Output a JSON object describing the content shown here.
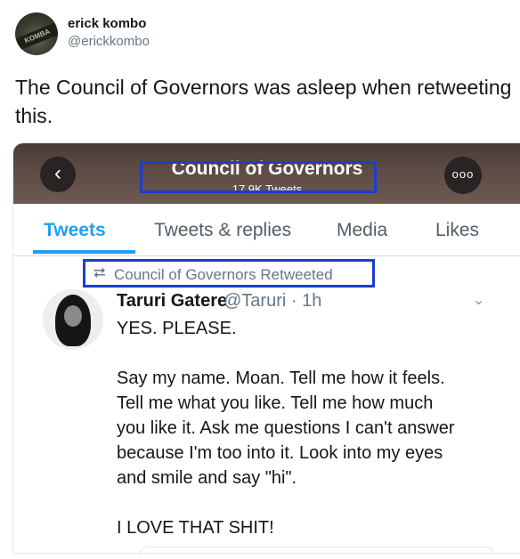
{
  "tweet": {
    "author_name": "erick kombo",
    "author_handle": "@erickkombo",
    "avatar_cap_text": "KOMBA",
    "text": "The Council of Governors was asleep when retweeting this."
  },
  "embedded": {
    "header": {
      "back_icon": "‹",
      "title": "Council of Governors",
      "subtitle": "17.9K Tweets",
      "more_icon": "ooo"
    },
    "tabs": [
      {
        "label": "Tweets",
        "active": true
      },
      {
        "label": "Tweets & replies",
        "active": false
      },
      {
        "label": "Media",
        "active": false
      },
      {
        "label": "Likes",
        "active": false
      }
    ],
    "retweet_icon": "⮂",
    "retweet_label": "Council of Governors Retweeted",
    "inner_tweet": {
      "name": "Taruri Gatere",
      "meta": "@Taruri · 1h",
      "chevron": "⌄",
      "body": "YES. PLEASE.\n\nSay my name. Moan. Tell me how it feels.\nTell me what you like. Tell me how much\nyou like it. Ask me questions I can't answer\nbecause I'm too into it. Look into my eyes\nand smile and say \"hi\".\n\nI LOVE THAT SHIT!"
    }
  },
  "colors": {
    "accent": "#1da1f2",
    "highlight_box": "#1d3dcf",
    "muted": "#657786"
  }
}
